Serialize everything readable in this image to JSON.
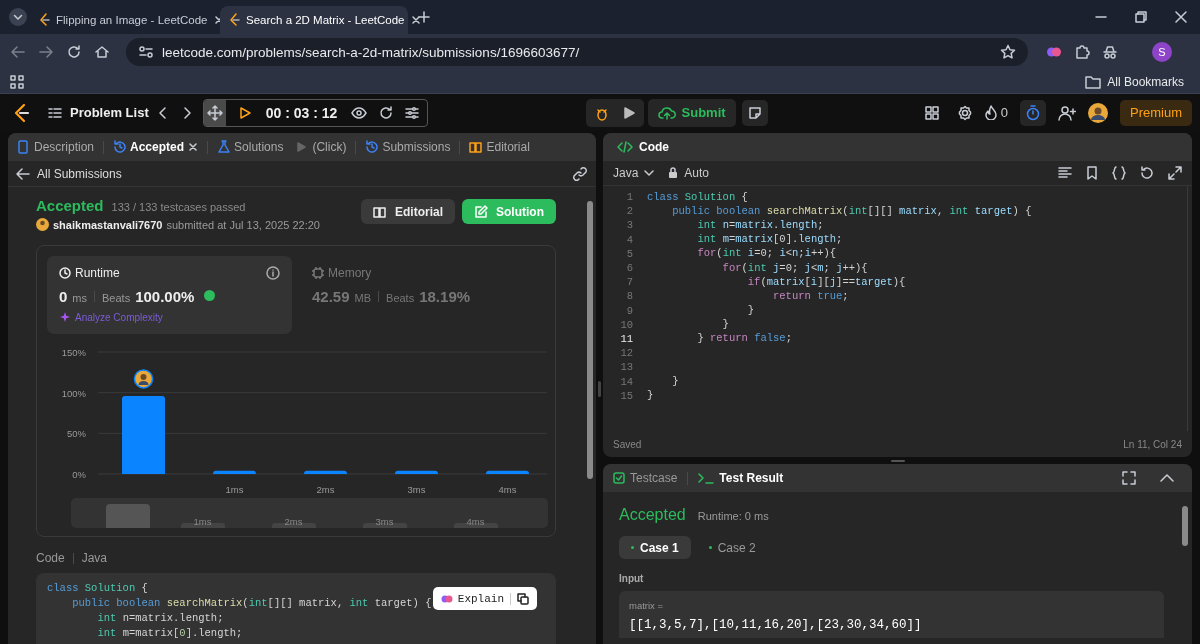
{
  "browser": {
    "tabs": [
      {
        "title": "Flipping an Image - LeetCode",
        "selected": false
      },
      {
        "title": "Search a 2D Matrix - LeetCode",
        "selected": true
      }
    ],
    "url": "leetcode.com/problems/search-a-2d-matrix/submissions/1696603677/",
    "profile_initial": "S",
    "bookmarks_label": "All Bookmarks"
  },
  "navbar": {
    "problem_list": "Problem List",
    "timer": "00 : 03 : 12",
    "submit": "Submit",
    "streak": "0",
    "premium": "Premium"
  },
  "left_panel": {
    "tabs": [
      {
        "label": "Description",
        "kind": "description",
        "selected": false,
        "closable": false
      },
      {
        "label": "Accepted",
        "kind": "accepted",
        "selected": true,
        "closable": true
      },
      {
        "label": "Solutions",
        "kind": "solutions",
        "selected": false,
        "closable": false
      },
      {
        "label": "(Click)",
        "kind": "click",
        "selected": false,
        "closable": false
      },
      {
        "label": "Submissions",
        "kind": "submissions",
        "selected": false,
        "closable": false
      },
      {
        "label": "Editorial",
        "kind": "editorial",
        "selected": false,
        "closable": false
      }
    ],
    "back_link": "All Submissions",
    "submission": {
      "status": "Accepted",
      "testcases": "133 / 133 testcases passed",
      "user": "shaikmastanvali7670",
      "submitted": "submitted at Jul 13, 2025 22:20",
      "buttons": [
        {
          "label": "Editorial",
          "kind": "editorial"
        },
        {
          "label": "Solution",
          "kind": "solution"
        }
      ]
    },
    "stats": [
      {
        "kind": "runtime",
        "title": "Runtime",
        "value": "0",
        "unit": "ms",
        "beats_label": "Beats",
        "beats": "100.00%",
        "analyze": "Analyze Complexity",
        "selected": true
      },
      {
        "kind": "memory",
        "title": "Memory",
        "value": "42.59",
        "unit": "MB",
        "beats_label": "Beats",
        "beats": "18.19%",
        "selected": false
      }
    ],
    "chart_data": {
      "type": "bar",
      "x": [
        0,
        1,
        2,
        3,
        4
      ],
      "values": [
        96,
        4,
        4,
        4,
        4
      ],
      "xlim": [
        -0.5,
        4.5
      ],
      "xticks": [
        {
          "value": 1,
          "label": "1ms"
        },
        {
          "value": 2,
          "label": "2ms"
        },
        {
          "value": 3,
          "label": "3ms"
        },
        {
          "value": 4,
          "label": "4ms"
        }
      ],
      "yticks": [
        {
          "value": 0,
          "label": "0%"
        },
        {
          "value": 50,
          "label": "50%"
        },
        {
          "value": 100,
          "label": "100%"
        },
        {
          "value": 150,
          "label": "150%"
        }
      ],
      "ylim": [
        0,
        150
      ]
    },
    "navigator": {
      "labels": [
        "1ms",
        "2ms",
        "3ms",
        "4ms"
      ]
    },
    "code_header": {
      "title": "Code",
      "language": "Java"
    },
    "code_lines": [
      [
        {
          "text": "class ",
          "kind": "keyword"
        },
        {
          "text": "Solution",
          "kind": "type"
        },
        {
          "text": " {",
          "kind": "plain"
        }
      ],
      [
        {
          "text": "    public boolean ",
          "kind": "keyword"
        },
        {
          "text": "searchMatrix",
          "kind": "function"
        },
        {
          "text": "(",
          "kind": "plain"
        },
        {
          "text": "int",
          "kind": "type"
        },
        {
          "text": "[][] matrix, ",
          "kind": "plain"
        },
        {
          "text": "int ",
          "kind": "type"
        },
        {
          "text": "target) {",
          "kind": "plain"
        }
      ],
      [
        {
          "text": "        int ",
          "kind": "type"
        },
        {
          "text": "n=matrix.length;",
          "kind": "plain"
        }
      ],
      [
        {
          "text": "        int ",
          "kind": "type"
        },
        {
          "text": "m=matrix[",
          "kind": "plain"
        },
        {
          "text": "0",
          "kind": "number"
        },
        {
          "text": "].length;",
          "kind": "plain"
        }
      ]
    ],
    "explain": "Explain"
  },
  "editor": {
    "title": "Code",
    "language": "Java",
    "mode": "Auto",
    "status": "Saved",
    "cursor": "Ln 11, Col 24",
    "lines": [
      {
        "number": "1",
        "current": false,
        "tokens": [
          {
            "text": "class ",
            "kind": "keyword"
          },
          {
            "text": "Solution",
            "kind": "type"
          },
          {
            "text": " {",
            "kind": "plain"
          }
        ]
      },
      {
        "number": "2",
        "current": false,
        "tokens": [
          {
            "text": "    public boolean ",
            "kind": "keyword"
          },
          {
            "text": "searchMatrix",
            "kind": "function"
          },
          {
            "text": "(",
            "kind": "plain"
          },
          {
            "text": "int",
            "kind": "type"
          },
          {
            "text": "[][] ",
            "kind": "plain"
          },
          {
            "text": "matrix",
            "kind": "variable"
          },
          {
            "text": ", ",
            "kind": "plain"
          },
          {
            "text": "int ",
            "kind": "type"
          },
          {
            "text": "target",
            "kind": "variable"
          },
          {
            "text": ") {",
            "kind": "plain"
          }
        ]
      },
      {
        "number": "3",
        "current": false,
        "tokens": [
          {
            "text": "        int ",
            "kind": "type"
          },
          {
            "text": "n",
            "kind": "variable"
          },
          {
            "text": "=",
            "kind": "plain"
          },
          {
            "text": "matrix",
            "kind": "variable"
          },
          {
            "text": ".",
            "kind": "plain"
          },
          {
            "text": "length",
            "kind": "variable"
          },
          {
            "text": ";",
            "kind": "plain"
          }
        ]
      },
      {
        "number": "4",
        "current": false,
        "tokens": [
          {
            "text": "        int ",
            "kind": "type"
          },
          {
            "text": "m",
            "kind": "variable"
          },
          {
            "text": "=",
            "kind": "plain"
          },
          {
            "text": "matrix",
            "kind": "variable"
          },
          {
            "text": "[0].",
            "kind": "plain"
          },
          {
            "text": "length",
            "kind": "variable"
          },
          {
            "text": ";",
            "kind": "plain"
          }
        ]
      },
      {
        "number": "5",
        "current": false,
        "tokens": [
          {
            "text": "        for",
            "kind": "control"
          },
          {
            "text": "(",
            "kind": "plain"
          },
          {
            "text": "int ",
            "kind": "type"
          },
          {
            "text": "i",
            "kind": "variable"
          },
          {
            "text": "=0; ",
            "kind": "plain"
          },
          {
            "text": "i",
            "kind": "variable"
          },
          {
            "text": "<",
            "kind": "plain"
          },
          {
            "text": "n",
            "kind": "variable"
          },
          {
            "text": ";",
            "kind": "plain"
          },
          {
            "text": "i",
            "kind": "variable"
          },
          {
            "text": "++){",
            "kind": "plain"
          }
        ]
      },
      {
        "number": "6",
        "current": false,
        "tokens": [
          {
            "text": "            for",
            "kind": "control"
          },
          {
            "text": "(",
            "kind": "plain"
          },
          {
            "text": "int ",
            "kind": "type"
          },
          {
            "text": "j",
            "kind": "variable"
          },
          {
            "text": "=0; ",
            "kind": "plain"
          },
          {
            "text": "j",
            "kind": "variable"
          },
          {
            "text": "<",
            "kind": "plain"
          },
          {
            "text": "m",
            "kind": "variable"
          },
          {
            "text": "; ",
            "kind": "plain"
          },
          {
            "text": "j",
            "kind": "variable"
          },
          {
            "text": "++){",
            "kind": "plain"
          }
        ]
      },
      {
        "number": "7",
        "current": false,
        "tokens": [
          {
            "text": "                if",
            "kind": "control"
          },
          {
            "text": "(",
            "kind": "plain"
          },
          {
            "text": "matrix",
            "kind": "variable"
          },
          {
            "text": "[",
            "kind": "plain"
          },
          {
            "text": "i",
            "kind": "variable"
          },
          {
            "text": "][",
            "kind": "plain"
          },
          {
            "text": "j",
            "kind": "variable"
          },
          {
            "text": "]==",
            "kind": "plain"
          },
          {
            "text": "target",
            "kind": "variable"
          },
          {
            "text": "){",
            "kind": "plain"
          }
        ]
      },
      {
        "number": "8",
        "current": false,
        "tokens": [
          {
            "text": "                    return ",
            "kind": "control"
          },
          {
            "text": "true",
            "kind": "keyword"
          },
          {
            "text": ";",
            "kind": "plain"
          }
        ]
      },
      {
        "number": "9",
        "current": false,
        "tokens": [
          {
            "text": "                }",
            "kind": "plain"
          }
        ]
      },
      {
        "number": "10",
        "current": false,
        "tokens": [
          {
            "text": "            }",
            "kind": "plain"
          }
        ]
      },
      {
        "number": "11",
        "current": true,
        "tokens": [
          {
            "text": "        } ",
            "kind": "plain"
          },
          {
            "text": "return ",
            "kind": "control"
          },
          {
            "text": "false",
            "kind": "keyword"
          },
          {
            "text": ";",
            "kind": "plain"
          }
        ]
      },
      {
        "number": "12",
        "current": false
      },
      {
        "number": "13",
        "current": false
      },
      {
        "number": "14",
        "current": false,
        "tokens": [
          {
            "text": "    }",
            "kind": "plain"
          }
        ]
      },
      {
        "number": "15",
        "current": false,
        "tokens": [
          {
            "text": "}",
            "kind": "plain"
          }
        ]
      }
    ]
  },
  "test_panel": {
    "tabs": [
      {
        "label": "Testcase",
        "kind": "testcase",
        "selected": false
      },
      {
        "label": "Test Result",
        "kind": "result",
        "selected": true
      }
    ],
    "status": "Accepted",
    "runtime": "Runtime: 0 ms",
    "cases": [
      {
        "label": "Case 1",
        "selected": true
      },
      {
        "label": "Case 2",
        "selected": false
      }
    ],
    "input_label": "Input",
    "param_name": "matrix =",
    "param_value": "[[1,3,5,7],[10,11,16,20],[23,30,34,60]]"
  }
}
